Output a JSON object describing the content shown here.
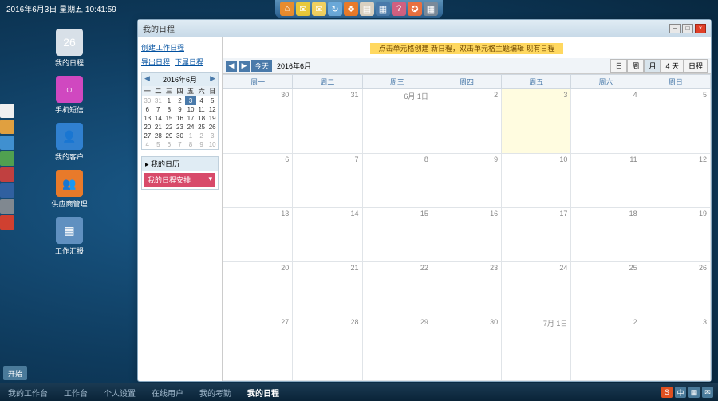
{
  "datetime": "2016年6月3日 星期五 10:41:59",
  "topicons": [
    "⌂",
    "✉",
    "✉",
    "↻",
    "❖",
    "▤",
    "▦",
    "?",
    "✪",
    "▦"
  ],
  "desk": [
    {
      "label": "我的日程",
      "color": "#d8e0e8",
      "glyph": "26"
    },
    {
      "label": "手机短信",
      "color": "#d048c0",
      "glyph": "○"
    },
    {
      "label": "我的客户",
      "color": "#3080d0",
      "glyph": "👤"
    },
    {
      "label": "供应商管理",
      "color": "#e87a2a",
      "glyph": "👥"
    },
    {
      "label": "工作汇报",
      "color": "#6090c0",
      "glyph": "▦"
    }
  ],
  "leftdock": [
    "#f0f0f0",
    "#e0a040",
    "#4090d0",
    "#50a050",
    "#c04040",
    "#3060a0",
    "#808890",
    "#d04030"
  ],
  "start": "开始",
  "taskbar": [
    {
      "label": "我的工作台",
      "active": false
    },
    {
      "label": "工作台",
      "active": false
    },
    {
      "label": "个人设置",
      "active": false
    },
    {
      "label": "在线用户",
      "active": false
    },
    {
      "label": "我的考勤",
      "active": false
    },
    {
      "label": "我的日程",
      "active": true
    }
  ],
  "window": {
    "title": "我的日程",
    "side": {
      "create": "创建工作日程",
      "export": "导出日程",
      "sub": "下属日程",
      "minical_title": "2016年6月",
      "dow": [
        "一",
        "二",
        "三",
        "四",
        "五",
        "六",
        "日"
      ],
      "weeks": [
        [
          {
            "d": 30,
            "o": true
          },
          {
            "d": 31,
            "o": true
          },
          {
            "d": 1
          },
          {
            "d": 2
          },
          {
            "d": 3,
            "t": true
          },
          {
            "d": 4
          },
          {
            "d": 5
          }
        ],
        [
          {
            "d": 6
          },
          {
            "d": 7
          },
          {
            "d": 8
          },
          {
            "d": 9
          },
          {
            "d": 10
          },
          {
            "d": 11
          },
          {
            "d": 12
          }
        ],
        [
          {
            "d": 13
          },
          {
            "d": 14
          },
          {
            "d": 15
          },
          {
            "d": 16
          },
          {
            "d": 17
          },
          {
            "d": 18
          },
          {
            "d": 19
          }
        ],
        [
          {
            "d": 20
          },
          {
            "d": 21
          },
          {
            "d": 22
          },
          {
            "d": 23
          },
          {
            "d": 24
          },
          {
            "d": 25
          },
          {
            "d": 26
          }
        ],
        [
          {
            "d": 27
          },
          {
            "d": 28
          },
          {
            "d": 29
          },
          {
            "d": 30
          },
          {
            "d": 1,
            "o": true
          },
          {
            "d": 2,
            "o": true
          },
          {
            "d": 3,
            "o": true
          }
        ],
        [
          {
            "d": 4,
            "o": true
          },
          {
            "d": 5,
            "o": true
          },
          {
            "d": 6,
            "o": true
          },
          {
            "d": 7,
            "o": true
          },
          {
            "d": 8,
            "o": true
          },
          {
            "d": 9,
            "o": true
          },
          {
            "d": 10,
            "o": true
          }
        ]
      ],
      "mycal_hdr": "▸ 我的日历",
      "mycal_sel": "我的日程安排"
    },
    "toolbar": {
      "today": "今天",
      "ym": "2016年6月",
      "views": [
        "日",
        "周",
        "月",
        "4 天",
        "日程"
      ],
      "activeView": 2
    },
    "hint": "点击单元格创建 新日程，双击单元格主题编辑 现有日程",
    "headers": [
      "周一",
      "周二",
      "周三",
      "周四",
      "周五",
      "周六",
      "周日"
    ],
    "rows": [
      [
        {
          "d": "30"
        },
        {
          "d": "31"
        },
        {
          "d": "6月 1日"
        },
        {
          "d": "2"
        },
        {
          "d": "3",
          "t": true
        },
        {
          "d": "4"
        },
        {
          "d": "5"
        }
      ],
      [
        {
          "d": "6"
        },
        {
          "d": "7"
        },
        {
          "d": "8"
        },
        {
          "d": "9"
        },
        {
          "d": "10"
        },
        {
          "d": "11"
        },
        {
          "d": "12"
        }
      ],
      [
        {
          "d": "13"
        },
        {
          "d": "14"
        },
        {
          "d": "15"
        },
        {
          "d": "16"
        },
        {
          "d": "17"
        },
        {
          "d": "18"
        },
        {
          "d": "19"
        }
      ],
      [
        {
          "d": "20"
        },
        {
          "d": "21"
        },
        {
          "d": "22"
        },
        {
          "d": "23"
        },
        {
          "d": "24"
        },
        {
          "d": "25"
        },
        {
          "d": "26"
        }
      ],
      [
        {
          "d": "27"
        },
        {
          "d": "28"
        },
        {
          "d": "29"
        },
        {
          "d": "30"
        },
        {
          "d": "7月 1日"
        },
        {
          "d": "2"
        },
        {
          "d": "3"
        }
      ]
    ]
  }
}
